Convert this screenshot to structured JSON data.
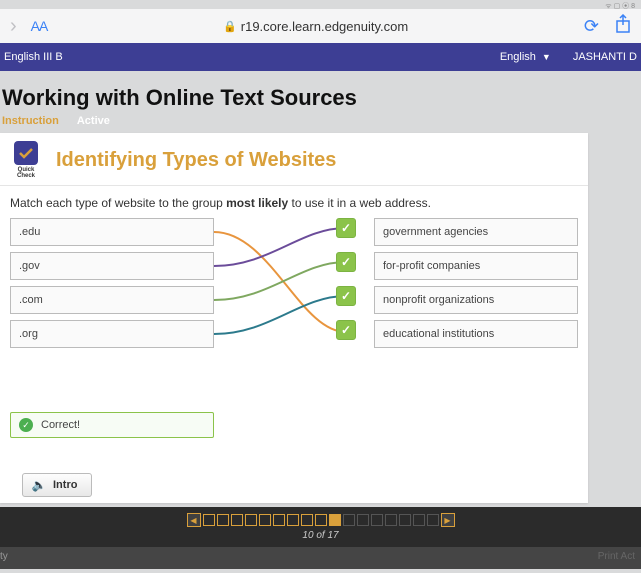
{
  "status": {
    "icons": "ᯤ ▢ ⦿ 8"
  },
  "browser": {
    "url": "r19.core.learn.edgenuity.com",
    "text_size": "AA"
  },
  "course_bar": {
    "course": "English III B",
    "language": "English",
    "user": "JASHANTI D"
  },
  "page": {
    "title": "Working with Online Text Sources",
    "tab_instruction": "Instruction",
    "tab_active": "Active"
  },
  "card": {
    "badge_label": "Quick Check",
    "title": "Identifying Types of Websites",
    "instruction_pre": "Match each type of website to the group ",
    "instruction_bold": "most likely",
    "instruction_post": " to use it in a web address."
  },
  "left_items": [
    ".edu",
    ".gov",
    ".com",
    ".org"
  ],
  "right_items": [
    "government agencies",
    "for-profit companies",
    "nonprofit organizations",
    "educational institutions"
  ],
  "feedback": {
    "text": "Correct!"
  },
  "intro_button": "Intro",
  "pager": {
    "total": 17,
    "current": 10,
    "text": "10 of 17"
  },
  "bottom": {
    "left": "ty",
    "right": "Print Act"
  }
}
